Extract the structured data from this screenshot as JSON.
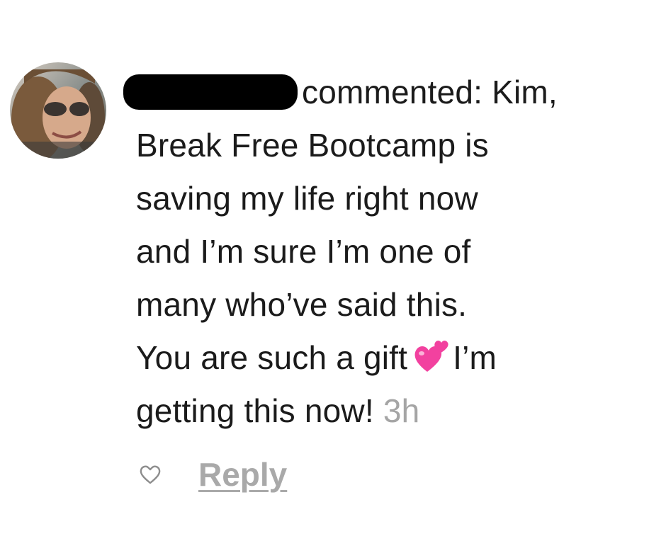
{
  "comment": {
    "author_redacted": true,
    "line1_suffix": "commented: Kim,",
    "line2": "Break Free Bootcamp is",
    "line3": "saving my life right now",
    "line4": "and I’m sure I’m one of",
    "line5": "many who’ve said this.",
    "line6_before_emoji": "You are such a gift",
    "emoji": "two-hearts-icon",
    "line6_after_emoji": "I’m",
    "line7": "getting this now!",
    "timestamp": "3h"
  },
  "actions": {
    "like_icon": "heart-outline-icon",
    "reply_label": "Reply"
  },
  "colors": {
    "text": "#1b1b1b",
    "muted": "#a5a5a5",
    "emoji_pink": "#f2419f",
    "redaction": "#000000"
  }
}
